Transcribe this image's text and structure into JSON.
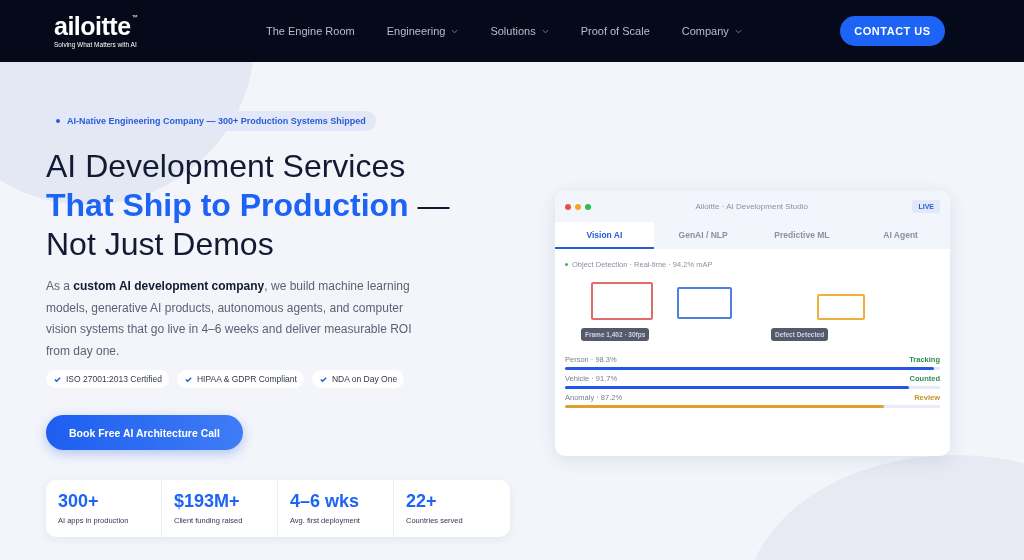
{
  "header": {
    "logo": "ailoitte",
    "logo_mark": "™",
    "tagline": "Solving What Matters with AI",
    "nav": [
      {
        "label": "The Engine Room",
        "has_menu": false
      },
      {
        "label": "Engineering",
        "has_menu": true
      },
      {
        "label": "Solutions",
        "has_menu": true
      },
      {
        "label": "Proof of Scale",
        "has_menu": false
      },
      {
        "label": "Company",
        "has_menu": true
      }
    ],
    "cta": "CONTACT US"
  },
  "hero": {
    "badge": "AI-Native Engineering Company — 300+ Production Systems Shipped",
    "heading": [
      "AI Development Services",
      "**That Ship to Production** —",
      "Not Just Demos"
    ],
    "intro": "As a **custom AI development company**, we build machine learning models, generative AI products, autonomous agents, and computer vision systems that go live in 4–6 weeks and deliver measurable ROI from day one.",
    "certifications": [
      "ISO 27001:2013 Certified",
      "HIPAA & GDPR Compliant",
      "NDA on Day One"
    ],
    "button": "Book Free AI Architecture Call",
    "stats": [
      {
        "value": "300+",
        "label": "AI apps in production"
      },
      {
        "value": "$193M+",
        "label": "Client funding raised"
      },
      {
        "value": "4–6 wks",
        "label": "Avg. first deployment"
      },
      {
        "value": "22+",
        "label": "Countries served"
      }
    ]
  },
  "studio": {
    "title": "Ailoitte · AI Development Studio",
    "live": "LIVE",
    "tabs": [
      {
        "label": "Vision AI",
        "selected": true
      },
      {
        "label": "GenAI / NLP",
        "selected": false
      },
      {
        "label": "Predictive ML",
        "selected": false
      },
      {
        "label": "AI Agent",
        "selected": false
      }
    ],
    "status": "Object Detection · Real-time · 94.2% mAP",
    "boxes": [
      {
        "color": "#e06b6b"
      },
      {
        "color": "#4f7fe0"
      },
      {
        "color": "#eab23a"
      }
    ],
    "tags": [
      "Frame 1,402 · 30fps",
      "Defect Detected"
    ],
    "metrics": [
      {
        "label": "Person · 98.3%",
        "status": "Tracking",
        "level": 0.983,
        "color": "#2255e8",
        "kind": "ok"
      },
      {
        "label": "Vehicle · 91.7%",
        "status": "Counted",
        "level": 0.917,
        "color": "#2255e8",
        "kind": "ok"
      },
      {
        "label": "Anomaly · 87.2%",
        "status": "Review",
        "level": 0.85,
        "color": "#e0a030",
        "kind": "warning"
      }
    ]
  }
}
